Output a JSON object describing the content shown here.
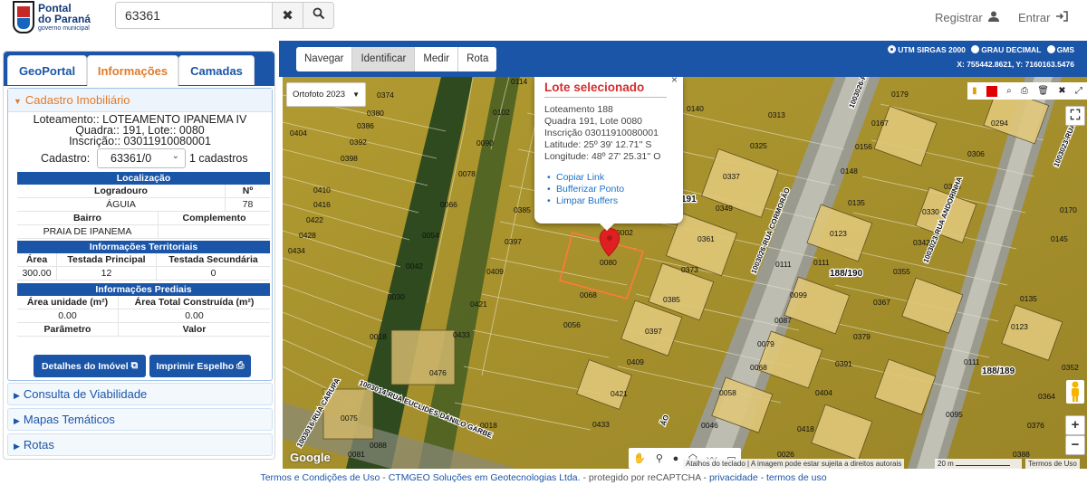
{
  "logo": {
    "line1": "Pontal",
    "line2": "do Paraná",
    "line3": "governo municipal"
  },
  "search": {
    "value": "63361",
    "clear_icon": "times-icon",
    "search_icon": "search-icon"
  },
  "header": {
    "register_label": "Registrar",
    "login_label": "Entrar"
  },
  "tabs": [
    {
      "label": "GeoPortal",
      "active": false
    },
    {
      "label": "Informações",
      "active": true
    },
    {
      "label": "Camadas",
      "active": false
    }
  ],
  "cadastro": {
    "section_title": "Cadastro Imobiliário",
    "loteamento_label": "Loteamento:",
    "loteamento_value": ": LOTEAMENTO IPANEMA IV",
    "quadra_label": "Quadra:",
    "quadra_value": ": 191,",
    "lote_label": "Lote:",
    "lote_value": ": 0080",
    "inscricao_label": "Inscrição:",
    "inscricao_value": ": 03011910080001",
    "cadastro_label": "Cadastro:",
    "cadastro_select": "63361/0",
    "cadastro_count": "1 cadastros"
  },
  "localizacao": {
    "title": "Localização",
    "headers": [
      "Logradouro",
      "Nº"
    ],
    "values": [
      "ÁGUIA",
      "78"
    ],
    "headers2": [
      "Bairro",
      "Complemento"
    ],
    "values2": [
      "PRAIA DE IPANEMA",
      ""
    ]
  },
  "territoriais": {
    "title": "Informações Territoriais",
    "headers": [
      "Área",
      "Testada Principal",
      "Testada Secundária"
    ],
    "values": [
      "300.00",
      "12",
      "0"
    ]
  },
  "prediais": {
    "title": "Informações Prediais",
    "headers": [
      "Área unidade (m²)",
      "Área Total Construída (m²)"
    ],
    "values": [
      "0.00",
      "0.00"
    ],
    "headers2": [
      "Parâmetro",
      "Valor"
    ]
  },
  "buttons": {
    "detalhes": "Detalhes do Imóvel",
    "imprimir": "Imprimir Espelho"
  },
  "accordions": [
    "Consulta de Viabilidade",
    "Mapas Temáticos",
    "Rotas"
  ],
  "maptools": [
    "Navegar",
    "Identificar",
    "Medir",
    "Rota"
  ],
  "maptools_active": "Identificar",
  "coord_options": [
    "UTM SIRGAS 2000",
    "GRAU DECIMAL",
    "GMS"
  ],
  "coord_selected": "UTM SIRGAS 2000",
  "coord_readout": "X: 755442.8621, Y: 7160163.5476",
  "ortho_select": "Ortofoto 2023",
  "popup": {
    "title": "Lote selecionado",
    "lines": [
      "Loteamento 188",
      "Quadra 191, Lote 0080",
      "Inscrição 03011910080001",
      "Latitude: 25º 39' 12.71'' S",
      "Longitude: 48º 27' 25.31'' O"
    ],
    "links": [
      "Copiar Link",
      "Bufferizar Ponto",
      "Limpar Buffers"
    ]
  },
  "map_labels": {
    "lots": [
      "0114",
      "0374",
      "0380",
      "0386",
      "0392",
      "0398",
      "0404",
      "0410",
      "0416",
      "0422",
      "0428",
      "0434",
      "0102",
      "0090",
      "0078",
      "0066",
      "0054",
      "0042",
      "0030",
      "0385",
      "0397",
      "0409",
      "0421",
      "0433",
      "0018",
      "0476",
      "0068",
      "0056",
      "0002",
      "0080",
      "0373",
      "0385",
      "0397",
      "0409",
      "0421",
      "0433",
      "0140",
      "0313",
      "0325",
      "0337",
      "0349",
      "0361",
      "0375",
      "0099",
      "0087",
      "0079",
      "0068",
      "0058",
      "0046",
      "0026",
      "0418",
      "0388",
      "0391",
      "0404",
      "0430",
      "0179",
      "0167",
      "0156",
      "0148",
      "0135",
      "0123",
      "0111",
      "0330",
      "0342",
      "0355",
      "0367",
      "0379",
      "0294",
      "0306",
      "0318",
      "0170",
      "0145",
      "0135",
      "0123",
      "0111",
      "0352",
      "0364",
      "0376",
      "0388",
      "0095",
      "0075",
      "0081"
    ],
    "blocks": [
      "191",
      "188/190",
      "188/189"
    ],
    "streets": [
      "1003026-RUA CORMORÃO",
      "1003023-RUA ANDORINHA",
      "1003014-RUA EUCLIDES DANILO GARBE",
      "1003016-RUA CARUPA",
      "ÃO",
      "LOTE"
    ]
  },
  "map_footer": {
    "google": "Google",
    "shortcuts": "Atalhos do teclado",
    "notice": "A imagem pode estar sujeita a direitos autorais",
    "scale": "20 m",
    "terms": "Termos de Uso"
  },
  "footer": {
    "terms": "Termos e Condições de Uso",
    "sep1": " - ",
    "company": "CTMGEO Soluções em Geotecnologias Ltda.",
    "protected": " - protegido por reCAPTCHA - ",
    "privacy": "privacidade",
    "sep2": " - ",
    "terms2": "termos de uso"
  },
  "colors": {
    "primary": "#1a55a8",
    "accent": "#e07b2a",
    "popup_title": "#d32f2f",
    "marker": "#e02020"
  }
}
